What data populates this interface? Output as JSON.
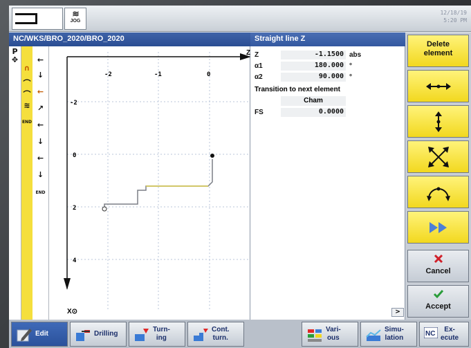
{
  "header": {
    "mode_icon": "bracket-icon",
    "mode_label": "JOG",
    "date": "12/18/19",
    "time": "5:20 PM"
  },
  "path": "NC/WKS/BRO_2020/BRO_2020",
  "element_title": "Straight line Z",
  "graphic": {
    "axis_z_label": "Z",
    "axis_x_label": "X⊙",
    "z_ticks": [
      "-2",
      "-1",
      "0"
    ],
    "x_ticks": [
      "-2",
      "0",
      "2",
      "4"
    ]
  },
  "params": {
    "rows": [
      {
        "label": "Z",
        "value": "-1.1500",
        "unit": "abs"
      },
      {
        "label": "α1",
        "value": "180.000",
        "unit": "°"
      },
      {
        "label": "α2",
        "value": "90.000",
        "unit": "°"
      }
    ],
    "transition_label": "Transition to next element",
    "transition_value": "Cham",
    "fs_label": "FS",
    "fs_value": "0.0000"
  },
  "left_strip": {
    "p_label": "P",
    "end_label": "END",
    "end_label2": "END"
  },
  "vkeys": {
    "delete_label1": "Delete",
    "delete_label2": "element",
    "cancel_label": "Cancel",
    "accept_label": "Accept"
  },
  "hkeys": [
    {
      "line1": "Edit",
      "line2": ""
    },
    {
      "line1": "Drilling",
      "line2": ""
    },
    {
      "line1": "Turn-",
      "line2": "ing"
    },
    {
      "line1": "Cont.",
      "line2": "turn."
    },
    {
      "line1": "Vari-",
      "line2": "ous"
    },
    {
      "line1": "Simu-",
      "line2": "lation"
    },
    {
      "line1": "Ex-",
      "line2": "ecute"
    }
  ],
  "colors": {
    "accent_blue": "#2a4d93",
    "softkey_yellow": "#f2d81f",
    "cancel_red": "#d0202a",
    "accept_green": "#2a9d3a",
    "contour_yellow": "#d8c94a"
  }
}
